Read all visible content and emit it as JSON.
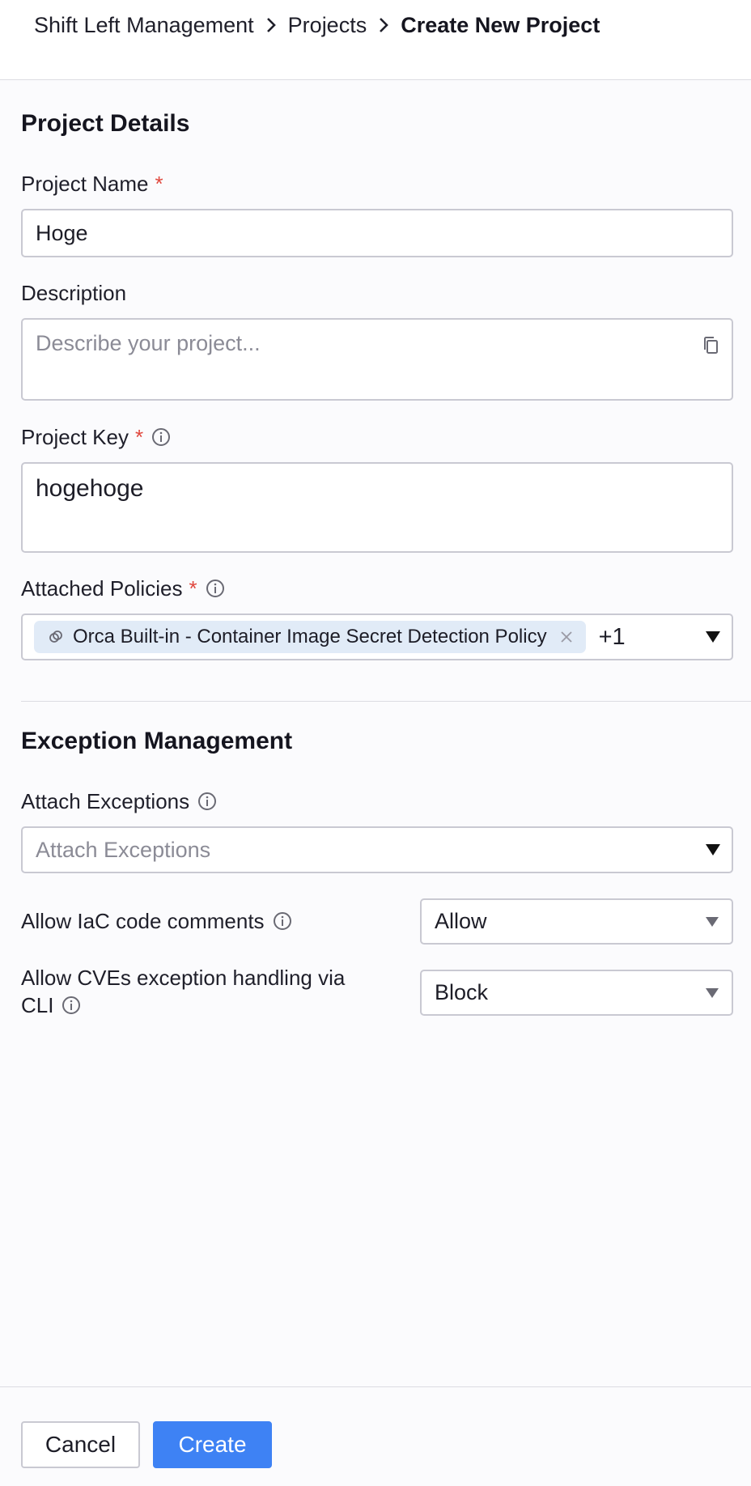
{
  "breadcrumb": {
    "items": [
      "Shift Left Management",
      "Projects"
    ],
    "current": "Create New Project"
  },
  "project_details": {
    "title": "Project Details",
    "project_name": {
      "label": "Project Name",
      "required_mark": "*",
      "value": "Hoge"
    },
    "description": {
      "label": "Description",
      "placeholder": "Describe your project...",
      "value": ""
    },
    "project_key": {
      "label": "Project Key",
      "required_mark": "*",
      "value": "hogehoge"
    },
    "attached_policies": {
      "label": "Attached Policies",
      "required_mark": "*",
      "chip_label": "Orca Built-in - Container Image Secret Detection Policy",
      "more_count": "+1"
    }
  },
  "exception_management": {
    "title": "Exception Management",
    "attach_exceptions": {
      "label": "Attach Exceptions",
      "placeholder": "Attach Exceptions"
    },
    "iac_comments": {
      "label": "Allow IaC code comments",
      "value": "Allow"
    },
    "cve_cli": {
      "label_line1": "Allow CVEs exception handling via",
      "label_line2": "CLI",
      "value": "Block"
    }
  },
  "footer": {
    "cancel_label": "Cancel",
    "create_label": "Create"
  },
  "colors": {
    "primary": "#3e82f4",
    "required": "#e0483e",
    "chip_bg": "#e1ebf7"
  },
  "icons": {
    "breadcrumb_separator": "chevron-right-icon",
    "info": "info-icon",
    "description_action": "copy-icon",
    "chip": "policy-icon",
    "chip_remove": "close-icon",
    "dropdown": "caret-down-icon"
  }
}
